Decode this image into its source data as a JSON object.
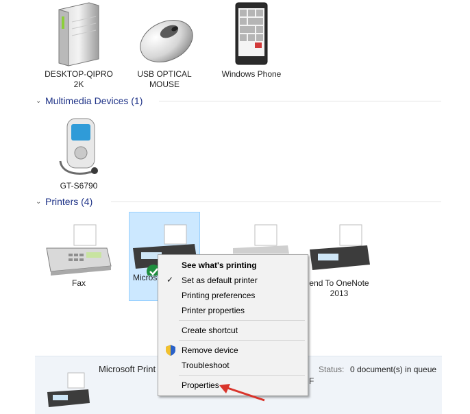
{
  "devices": {
    "pc": "DESKTOP-QIPRO\n2K",
    "mouse": "USB OPTICAL\nMOUSE",
    "phone": "Windows Phone"
  },
  "multimedia": {
    "header": "Multimedia Devices (1)",
    "items": [
      "GT-S6790"
    ]
  },
  "printers": {
    "header": "Printers (4)",
    "fax": "Fax",
    "ms_print_partial": "Micros",
    "onenote": "end To OneNote\n2013"
  },
  "context_menu": {
    "items": [
      {
        "label": "See what's printing",
        "bold": true
      },
      {
        "label": "Set as default printer",
        "check": true
      },
      {
        "label": "Printing preferences"
      },
      {
        "label": "Printer properties"
      },
      {
        "label": "Create shortcut"
      },
      {
        "label": "Remove device",
        "shield": true
      },
      {
        "label": "Troubleshoot"
      },
      {
        "label": "Properties"
      }
    ]
  },
  "details_pane": {
    "name_partial": "Microsoft Print",
    "status_label": "Status:",
    "status_value": "0 document(s) in queue",
    "partial_char": "F"
  },
  "colors": {
    "selection": "#cce8ff",
    "accent_text": "#1e3287",
    "arrow": "#d9342b"
  }
}
